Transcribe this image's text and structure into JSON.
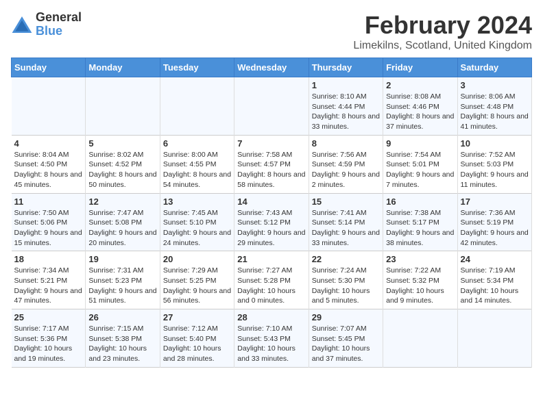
{
  "logo": {
    "general": "General",
    "blue": "Blue"
  },
  "title": "February 2024",
  "subtitle": "Limekilns, Scotland, United Kingdom",
  "days_of_week": [
    "Sunday",
    "Monday",
    "Tuesday",
    "Wednesday",
    "Thursday",
    "Friday",
    "Saturday"
  ],
  "weeks": [
    [
      {
        "day": "",
        "info": ""
      },
      {
        "day": "",
        "info": ""
      },
      {
        "day": "",
        "info": ""
      },
      {
        "day": "",
        "info": ""
      },
      {
        "day": "1",
        "info": "Sunrise: 8:10 AM\nSunset: 4:44 PM\nDaylight: 8 hours\nand 33 minutes."
      },
      {
        "day": "2",
        "info": "Sunrise: 8:08 AM\nSunset: 4:46 PM\nDaylight: 8 hours\nand 37 minutes."
      },
      {
        "day": "3",
        "info": "Sunrise: 8:06 AM\nSunset: 4:48 PM\nDaylight: 8 hours\nand 41 minutes."
      }
    ],
    [
      {
        "day": "4",
        "info": "Sunrise: 8:04 AM\nSunset: 4:50 PM\nDaylight: 8 hours\nand 45 minutes."
      },
      {
        "day": "5",
        "info": "Sunrise: 8:02 AM\nSunset: 4:52 PM\nDaylight: 8 hours\nand 50 minutes."
      },
      {
        "day": "6",
        "info": "Sunrise: 8:00 AM\nSunset: 4:55 PM\nDaylight: 8 hours\nand 54 minutes."
      },
      {
        "day": "7",
        "info": "Sunrise: 7:58 AM\nSunset: 4:57 PM\nDaylight: 8 hours\nand 58 minutes."
      },
      {
        "day": "8",
        "info": "Sunrise: 7:56 AM\nSunset: 4:59 PM\nDaylight: 9 hours\nand 2 minutes."
      },
      {
        "day": "9",
        "info": "Sunrise: 7:54 AM\nSunset: 5:01 PM\nDaylight: 9 hours\nand 7 minutes."
      },
      {
        "day": "10",
        "info": "Sunrise: 7:52 AM\nSunset: 5:03 PM\nDaylight: 9 hours\nand 11 minutes."
      }
    ],
    [
      {
        "day": "11",
        "info": "Sunrise: 7:50 AM\nSunset: 5:06 PM\nDaylight: 9 hours\nand 15 minutes."
      },
      {
        "day": "12",
        "info": "Sunrise: 7:47 AM\nSunset: 5:08 PM\nDaylight: 9 hours\nand 20 minutes."
      },
      {
        "day": "13",
        "info": "Sunrise: 7:45 AM\nSunset: 5:10 PM\nDaylight: 9 hours\nand 24 minutes."
      },
      {
        "day": "14",
        "info": "Sunrise: 7:43 AM\nSunset: 5:12 PM\nDaylight: 9 hours\nand 29 minutes."
      },
      {
        "day": "15",
        "info": "Sunrise: 7:41 AM\nSunset: 5:14 PM\nDaylight: 9 hours\nand 33 minutes."
      },
      {
        "day": "16",
        "info": "Sunrise: 7:38 AM\nSunset: 5:17 PM\nDaylight: 9 hours\nand 38 minutes."
      },
      {
        "day": "17",
        "info": "Sunrise: 7:36 AM\nSunset: 5:19 PM\nDaylight: 9 hours\nand 42 minutes."
      }
    ],
    [
      {
        "day": "18",
        "info": "Sunrise: 7:34 AM\nSunset: 5:21 PM\nDaylight: 9 hours\nand 47 minutes."
      },
      {
        "day": "19",
        "info": "Sunrise: 7:31 AM\nSunset: 5:23 PM\nDaylight: 9 hours\nand 51 minutes."
      },
      {
        "day": "20",
        "info": "Sunrise: 7:29 AM\nSunset: 5:25 PM\nDaylight: 9 hours\nand 56 minutes."
      },
      {
        "day": "21",
        "info": "Sunrise: 7:27 AM\nSunset: 5:28 PM\nDaylight: 10 hours\nand 0 minutes."
      },
      {
        "day": "22",
        "info": "Sunrise: 7:24 AM\nSunset: 5:30 PM\nDaylight: 10 hours\nand 5 minutes."
      },
      {
        "day": "23",
        "info": "Sunrise: 7:22 AM\nSunset: 5:32 PM\nDaylight: 10 hours\nand 9 minutes."
      },
      {
        "day": "24",
        "info": "Sunrise: 7:19 AM\nSunset: 5:34 PM\nDaylight: 10 hours\nand 14 minutes."
      }
    ],
    [
      {
        "day": "25",
        "info": "Sunrise: 7:17 AM\nSunset: 5:36 PM\nDaylight: 10 hours\nand 19 minutes."
      },
      {
        "day": "26",
        "info": "Sunrise: 7:15 AM\nSunset: 5:38 PM\nDaylight: 10 hours\nand 23 minutes."
      },
      {
        "day": "27",
        "info": "Sunrise: 7:12 AM\nSunset: 5:40 PM\nDaylight: 10 hours\nand 28 minutes."
      },
      {
        "day": "28",
        "info": "Sunrise: 7:10 AM\nSunset: 5:43 PM\nDaylight: 10 hours\nand 33 minutes."
      },
      {
        "day": "29",
        "info": "Sunrise: 7:07 AM\nSunset: 5:45 PM\nDaylight: 10 hours\nand 37 minutes."
      },
      {
        "day": "",
        "info": ""
      },
      {
        "day": "",
        "info": ""
      }
    ]
  ]
}
